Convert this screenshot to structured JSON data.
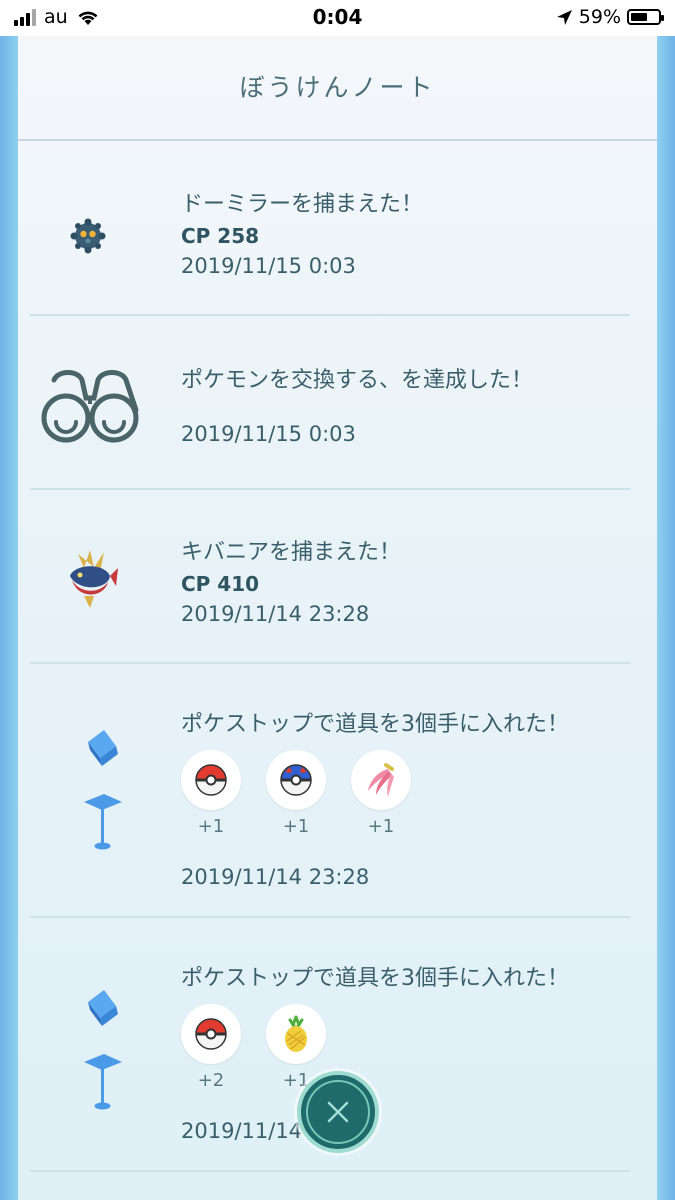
{
  "status_bar": {
    "carrier": "au",
    "time": "0:04",
    "battery": "59%"
  },
  "page": {
    "title": "ぼうけんノート"
  },
  "entries": [
    {
      "title": "ドーミラーを捕まえた！",
      "cp": "CP 258",
      "time": "2019/11/15 0:03",
      "icon": "bronzor-icon"
    },
    {
      "title": "ポケモンを交換する、を達成した！",
      "time": "2019/11/15 0:03",
      "icon": "binoculars-icon"
    },
    {
      "title": "キバニアを捕まえた！",
      "cp": "CP 410",
      "time": "2019/11/14 23:28",
      "icon": "carvanha-icon"
    },
    {
      "title": "ポケストップで道具を3個手に入れた！",
      "time": "2019/11/14 23:28",
      "icon": "pokestop-icon",
      "items": [
        {
          "icon": "poke-ball-icon",
          "count": "+1"
        },
        {
          "icon": "great-ball-icon",
          "count": "+1"
        },
        {
          "icon": "nanab-berry-icon",
          "count": "+1"
        }
      ]
    },
    {
      "title": "ポケストップで道具を3個手に入れた！",
      "time": "2019/11/14 23:28",
      "icon": "pokestop-icon",
      "items": [
        {
          "icon": "poke-ball-icon",
          "count": "+2"
        },
        {
          "icon": "pinap-berry-icon",
          "count": "+1"
        }
      ]
    }
  ],
  "colors": {
    "accent": "#1f6a6a",
    "text": "#3b5f6a",
    "background": "#8fd0ee"
  }
}
